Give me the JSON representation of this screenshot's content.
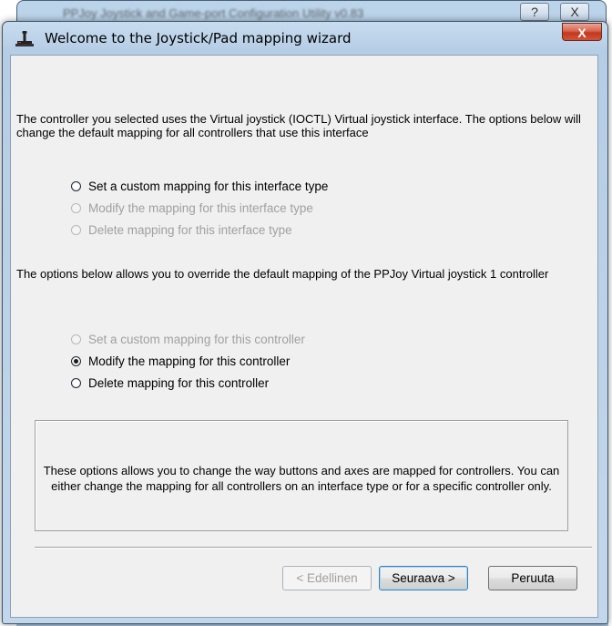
{
  "parent": {
    "title": "PPJoy Joystick and Game-port Configuration Utility v0.83",
    "help_label": "?",
    "close_label": "X"
  },
  "dialog": {
    "title": "Welcome to the Joystick/Pad mapping wizard",
    "close_label": "X",
    "intro_text": "The controller you selected uses the Virtual joystick (IOCTL) Virtual joystick interface. The options below will change the default mapping for all controllers that use this interface",
    "interface_options": [
      {
        "label": "Set a custom mapping for this interface type",
        "enabled": true,
        "checked": false
      },
      {
        "label": "Modify the mapping for this interface type",
        "enabled": false,
        "checked": false
      },
      {
        "label": "Delete mapping for this interface type",
        "enabled": false,
        "checked": false
      }
    ],
    "controller_text": "The options below allows you to override the default mapping of the PPJoy Virtual joystick 1 controller",
    "controller_options": [
      {
        "label": "Set a custom mapping for this controller",
        "enabled": false,
        "checked": false
      },
      {
        "label": "Modify the mapping for this controller",
        "enabled": true,
        "checked": true
      },
      {
        "label": "Delete mapping for this controller",
        "enabled": true,
        "checked": false
      }
    ],
    "info_text": "These options allows you to change the way buttons and axes are mapped for controllers. You can either change the mapping for all controllers on an interface type or for a specific controller only.",
    "buttons": {
      "back": "< Edellinen",
      "next": "Seuraava >",
      "cancel": "Peruuta"
    }
  }
}
